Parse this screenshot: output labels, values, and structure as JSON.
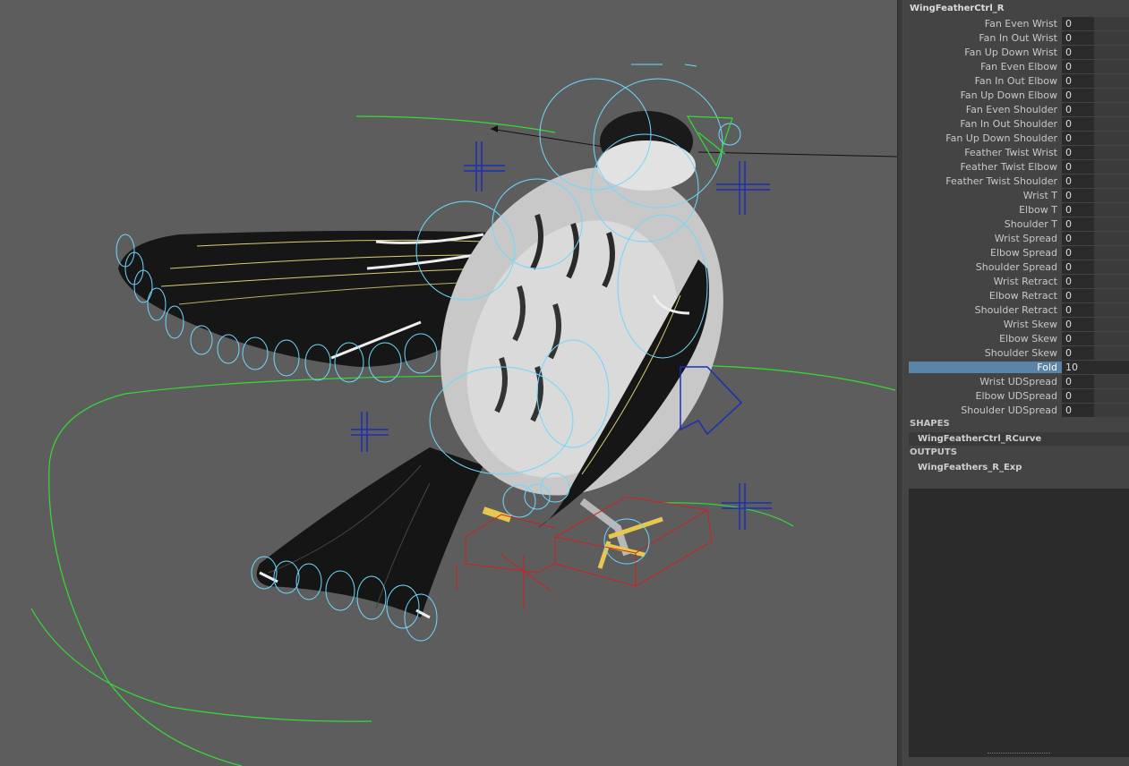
{
  "node_name": "WingFeatherCtrl_R",
  "attributes": [
    {
      "label": "Fan Even Wrist",
      "value": "0"
    },
    {
      "label": "Fan In Out Wrist",
      "value": "0"
    },
    {
      "label": "Fan Up Down Wrist",
      "value": "0"
    },
    {
      "label": "Fan Even Elbow",
      "value": "0"
    },
    {
      "label": "Fan In Out Elbow",
      "value": "0"
    },
    {
      "label": "Fan Up Down Elbow",
      "value": "0"
    },
    {
      "label": "Fan Even Shoulder",
      "value": "0"
    },
    {
      "label": "Fan In Out Shoulder",
      "value": "0"
    },
    {
      "label": "Fan Up Down Shoulder",
      "value": "0"
    },
    {
      "label": "Feather Twist Wrist",
      "value": "0"
    },
    {
      "label": "Feather Twist Elbow",
      "value": "0"
    },
    {
      "label": "Feather Twist Shoulder",
      "value": "0"
    },
    {
      "label": "Wrist T",
      "value": "0"
    },
    {
      "label": "Elbow T",
      "value": "0"
    },
    {
      "label": "Shoulder T",
      "value": "0"
    },
    {
      "label": "Wrist Spread",
      "value": "0"
    },
    {
      "label": "Elbow Spread",
      "value": "0"
    },
    {
      "label": "Shoulder Spread",
      "value": "0"
    },
    {
      "label": "Wrist Retract",
      "value": "0"
    },
    {
      "label": "Elbow Retract",
      "value": "0"
    },
    {
      "label": "Shoulder Retract",
      "value": "0"
    },
    {
      "label": "Wrist Skew",
      "value": "0"
    },
    {
      "label": "Elbow Skew",
      "value": "0"
    },
    {
      "label": "Shoulder Skew",
      "value": "0"
    },
    {
      "label": "Fold",
      "value": "10",
      "selected": true
    },
    {
      "label": "Wrist UDSpread",
      "value": "0"
    },
    {
      "label": "Elbow UDSpread",
      "value": "0"
    },
    {
      "label": "Shoulder UDSpread",
      "value": "0"
    }
  ],
  "shapes": {
    "header": "SHAPES",
    "items": [
      "WingFeatherCtrl_RCurve"
    ]
  },
  "outputs": {
    "header": "OUTPUTS",
    "items": [
      "WingFeathers_R_Exp"
    ]
  },
  "colors": {
    "viewport_bg": "#5d5d5d",
    "panel_bg": "#444444",
    "field_bg": "#2b2b2b",
    "selected": "#5a84a8",
    "control_cyan": "#6fd8ff",
    "control_blue": "#1a2fb8",
    "control_green": "#33dd33",
    "control_red": "#d02020"
  }
}
